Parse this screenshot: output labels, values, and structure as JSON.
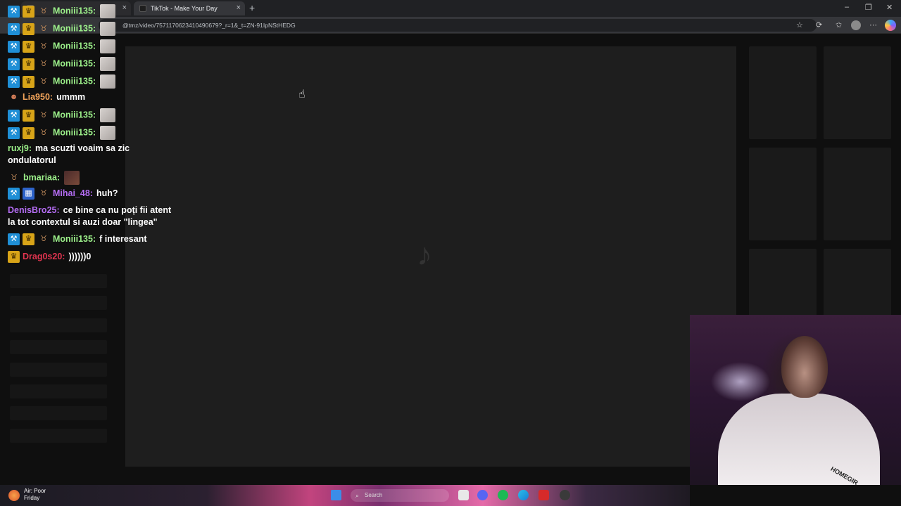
{
  "browser": {
    "tabs": [
      {
        "title": "",
        "active": false
      },
      {
        "title": "TikTok - Make Your Day",
        "active": true
      }
    ],
    "url": "@tmz/video/7571170623410490679?_r=1&_t=ZN-91IpNStHEDG"
  },
  "chat": {
    "messages": [
      {
        "badges": [
          "mod",
          "crown",
          "bull"
        ],
        "user": "Moniii135:",
        "user_color": "green",
        "text": "",
        "emote": "light"
      },
      {
        "badges": [
          "mod",
          "crown",
          "bull"
        ],
        "user": "Moniii135:",
        "user_color": "green",
        "text": "",
        "emote": "light"
      },
      {
        "badges": [
          "mod",
          "crown",
          "bull"
        ],
        "user": "Moniii135:",
        "user_color": "green",
        "text": "",
        "emote": "light"
      },
      {
        "badges": [
          "mod",
          "crown",
          "bull"
        ],
        "user": "Moniii135:",
        "user_color": "green",
        "text": "",
        "emote": "light"
      },
      {
        "badges": [
          "mod",
          "crown",
          "bull"
        ],
        "user": "Moniii135:",
        "user_color": "green",
        "text": "",
        "emote": "light"
      },
      {
        "badges": [
          "cat"
        ],
        "user": "Lia950:",
        "user_color": "orange",
        "text": "ummm"
      },
      {
        "badges": [
          "mod",
          "crown",
          "bull"
        ],
        "user": "Moniii135:",
        "user_color": "green",
        "text": "",
        "emote": "light"
      },
      {
        "badges": [
          "mod",
          "crown",
          "bull"
        ],
        "user": "Moniii135:",
        "user_color": "green",
        "text": "",
        "emote": "light"
      },
      {
        "badges": [],
        "user": "ruxj9:",
        "user_color": "green",
        "text": "ma scuzti voaim sa zic",
        "text2": "ondulatorul"
      },
      {
        "badges": [
          "bull"
        ],
        "user": "bmariaa:",
        "user_color": "green",
        "text": "",
        "emote": "dark"
      },
      {
        "badges": [
          "mod",
          "grid",
          "bull"
        ],
        "user": "Mihai_48:",
        "user_color": "purple",
        "text": "huh?"
      },
      {
        "badges": [],
        "user": "DenisBro25:",
        "user_color": "purple",
        "text": "ce bine ca nu poți fii atent",
        "text2": "la tot contextul si auzi doar \"lingea\""
      },
      {
        "badges": [
          "mod",
          "crown",
          "bull"
        ],
        "user": "Moniii135:",
        "user_color": "green",
        "text": "f interesant"
      },
      {
        "badges": [
          "crown"
        ],
        "user": "Drag0s20:",
        "user_color": "red",
        "text": "))))))0"
      }
    ]
  },
  "taskbar": {
    "weather_title": "Air: Poor",
    "weather_sub": "Friday",
    "search_placeholder": "Search"
  },
  "webcam": {
    "shirt_text": "HOMEGIR"
  }
}
